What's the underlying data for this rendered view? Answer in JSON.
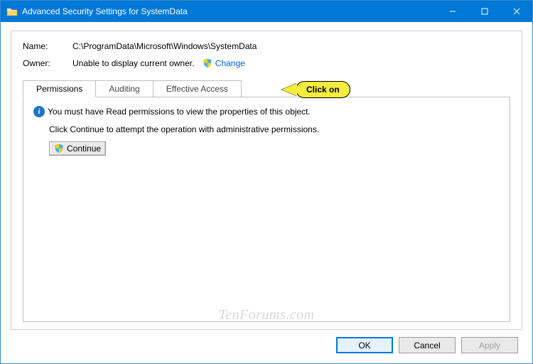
{
  "window": {
    "title": "Advanced Security Settings for SystemData"
  },
  "fields": {
    "name_label": "Name:",
    "name_value": "C:\\ProgramData\\Microsoft\\Windows\\SystemData",
    "owner_label": "Owner:",
    "owner_value": "Unable to display current owner.",
    "change_link": "Change"
  },
  "tabs": {
    "permissions": "Permissions",
    "auditing": "Auditing",
    "effective": "Effective Access"
  },
  "body": {
    "info_line": "You must have Read permissions to view the properties of this object.",
    "continue_hint": "Click Continue to attempt the operation with administrative permissions.",
    "continue_btn": "Continue"
  },
  "footer": {
    "ok": "OK",
    "cancel": "Cancel",
    "apply": "Apply"
  },
  "callout": {
    "text": "Click on"
  },
  "watermark": "TenForums.com"
}
